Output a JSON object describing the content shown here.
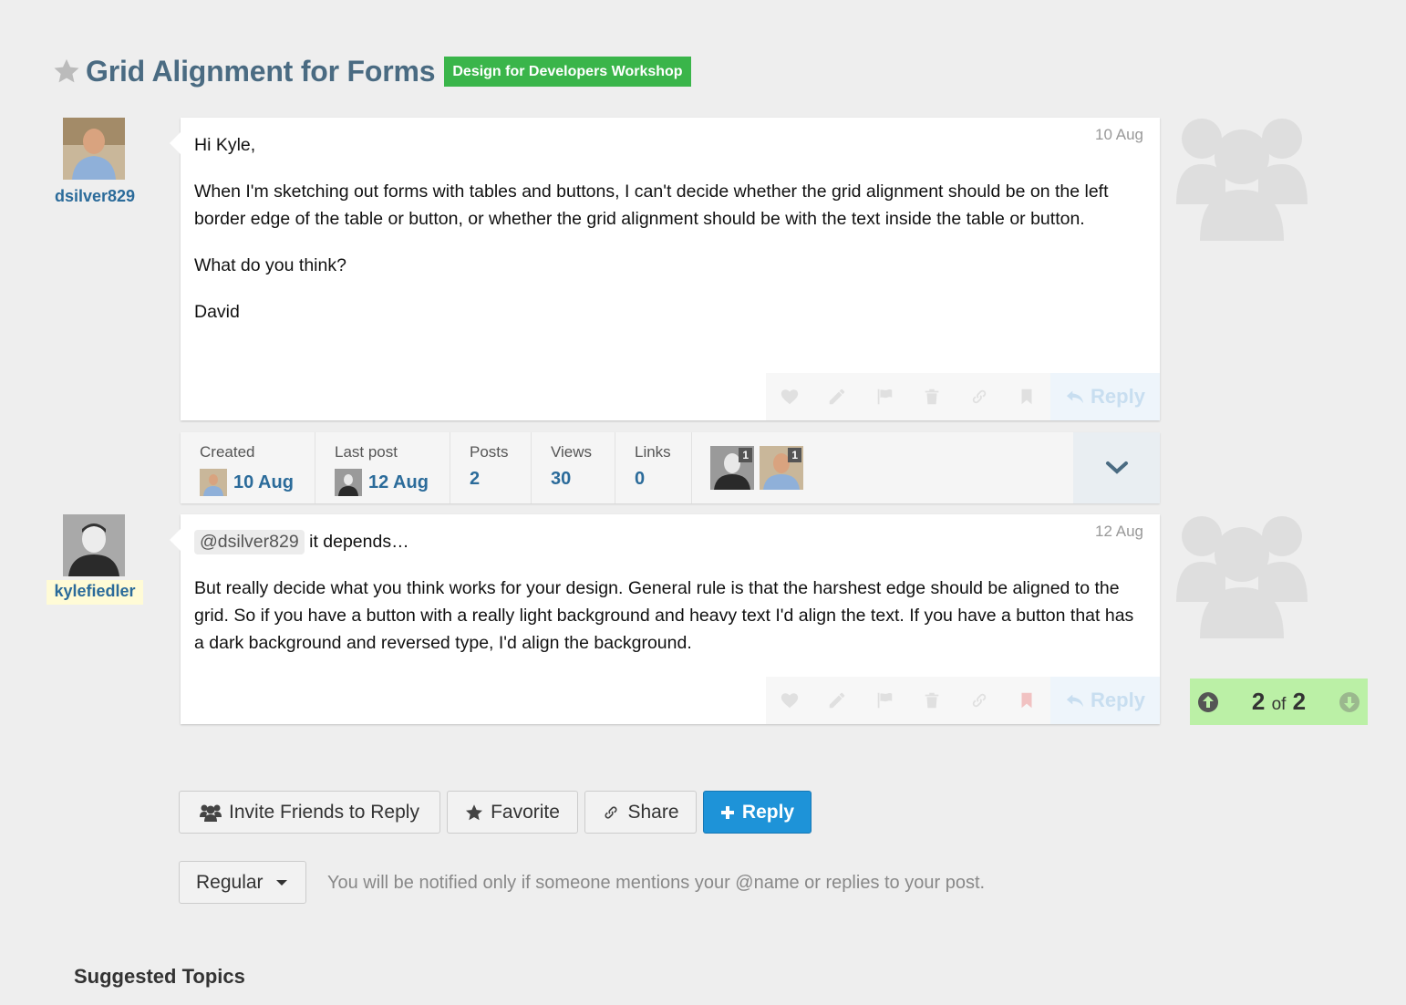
{
  "topic": {
    "title": "Grid Alignment for Forms",
    "category": "Design for Developers Workshop"
  },
  "posts": [
    {
      "username": "dsilver829",
      "date": "10 Aug",
      "paragraphs": [
        "Hi Kyle,",
        "When I'm sketching out forms with tables and buttons, I can't decide whether the grid alignment should be on the left border edge of the table or button, or whether the grid alignment should be with the text inside the table or button.",
        "What do you think?",
        "David"
      ]
    },
    {
      "username": "kylefiedler",
      "date": "12 Aug",
      "mention": "@dsilver829",
      "first_line_rest": " it depends…",
      "paragraph2": "But really decide what you think works for your design. General rule is that the harshest edge should be aligned to the grid. So if you have a button with a really light background and heavy text I'd align the text. If you have a button that has a dark background and reversed type, I'd align the background."
    }
  ],
  "post_actions": {
    "reply_label": "Reply"
  },
  "topic_map": {
    "created_label": "Created",
    "created_value": "10 Aug",
    "last_post_label": "Last post",
    "last_post_value": "12 Aug",
    "posts_label": "Posts",
    "posts_value": "2",
    "views_label": "Views",
    "views_value": "30",
    "links_label": "Links",
    "links_value": "0",
    "participants": [
      {
        "username": "kylefiedler",
        "count": "1"
      },
      {
        "username": "dsilver829",
        "count": "1"
      }
    ]
  },
  "progress": {
    "current": "2",
    "of": "of",
    "total": "2"
  },
  "footer_buttons": {
    "invite": "Invite Friends to Reply",
    "favorite": "Favorite",
    "share": "Share",
    "reply": "Reply"
  },
  "notifications": {
    "level": "Regular",
    "description": "You will be notified only if someone mentions your @name or replies to your post."
  },
  "suggested_heading": "Suggested Topics",
  "colors": {
    "title": "#4a6b82",
    "category": "#3ab54a",
    "link": "#2b6b9a",
    "primary_button": "#1e93d8",
    "progress_bg": "#bbf0a6"
  }
}
